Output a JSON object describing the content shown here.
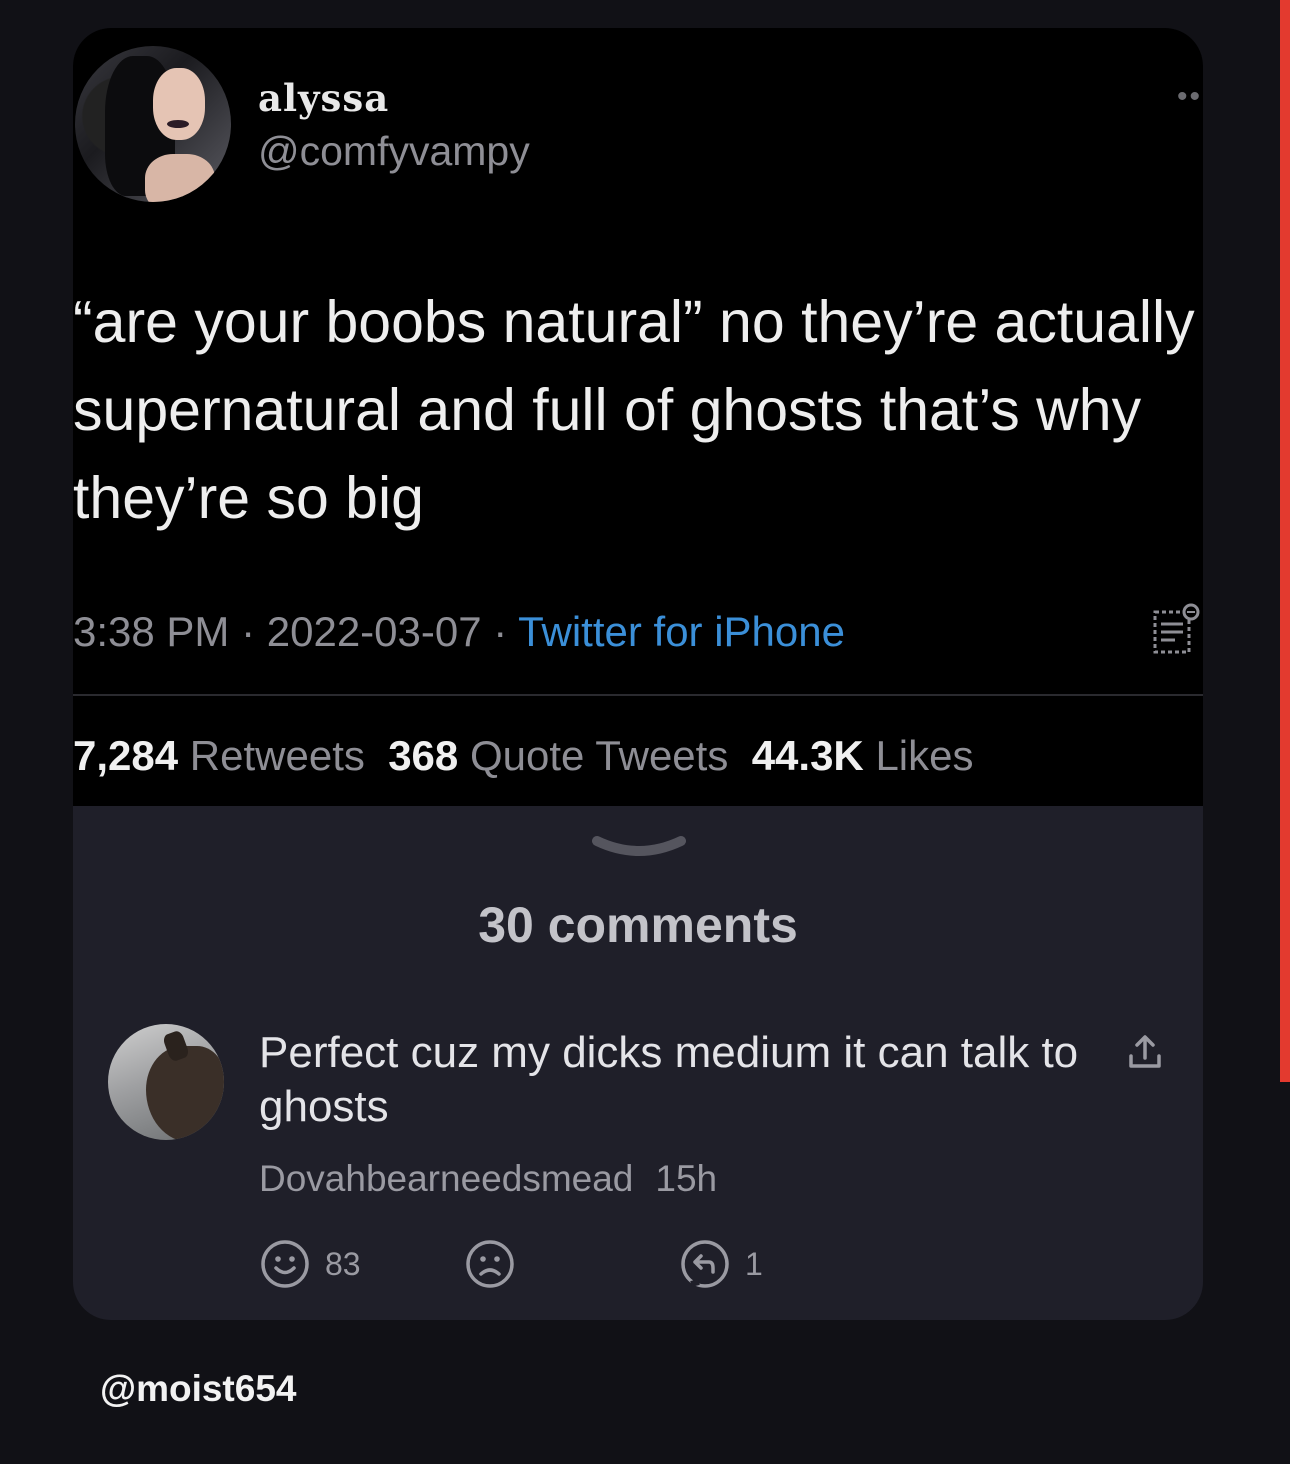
{
  "tweet": {
    "author_name": "alyssa",
    "author_handle": "@comfyvampy",
    "text": "“are your boobs natural” no they’re actually supernatural and full of ghosts that’s why they’re so big",
    "time": "3:38 PM",
    "separator": " · ",
    "date": "2022-03-07",
    "source": "Twitter for iPhone",
    "stats": {
      "retweets_count": "7,284",
      "retweets_label": "Retweets",
      "quotes_count": "368",
      "quotes_label": "Quote Tweets",
      "likes_count": "44.3K",
      "likes_label": "Likes"
    }
  },
  "comments": {
    "count_label": "30 comments",
    "items": [
      {
        "text": "Perfect cuz my dicks medium it can talk to ghosts",
        "author": "Dovahbearneedsmead",
        "time": "15h",
        "upvotes": "83",
        "replies": "1"
      }
    ]
  },
  "watermark": "@moist654",
  "colors": {
    "link": "#3b8fd8",
    "accent_edge": "#e33a2f",
    "card": "#1f1f29"
  },
  "icons": [
    "more-icon",
    "analytics-icon",
    "chevron-down-icon",
    "share-icon",
    "smile-icon",
    "frown-icon",
    "reply-icon"
  ]
}
